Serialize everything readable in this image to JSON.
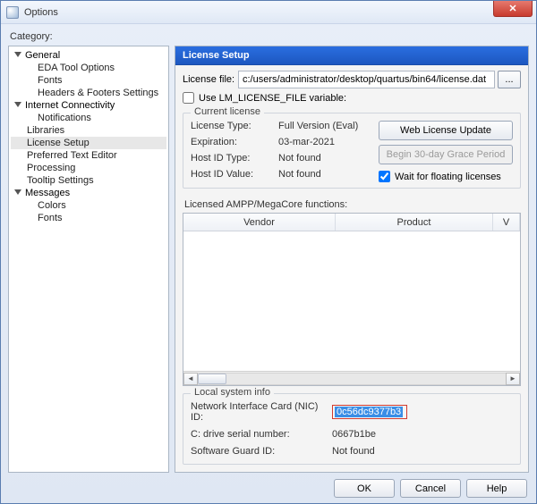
{
  "window": {
    "title": "Options"
  },
  "categoryLabel": "Category:",
  "tree": {
    "groups": [
      {
        "label": "General",
        "children": [
          {
            "label": "EDA Tool Options"
          },
          {
            "label": "Fonts"
          },
          {
            "label": "Headers & Footers Settings"
          }
        ]
      },
      {
        "label": "Internet Connectivity",
        "children": [
          {
            "label": "Notifications"
          }
        ]
      },
      {
        "label": "Libraries",
        "flat": true
      },
      {
        "label": "License Setup",
        "flat": true,
        "selected": true
      },
      {
        "label": "Preferred Text Editor",
        "flat": true
      },
      {
        "label": "Processing",
        "flat": true
      },
      {
        "label": "Tooltip Settings",
        "flat": true
      },
      {
        "label": "Messages",
        "children": [
          {
            "label": "Colors"
          },
          {
            "label": "Fonts"
          }
        ]
      }
    ]
  },
  "section": {
    "title": "License Setup"
  },
  "licenseFile": {
    "label": "License file:",
    "value": "c:/users/administrator/desktop/quartus/bin64/license.dat",
    "browse": "..."
  },
  "useEnvVar": {
    "label": "Use LM_LICENSE_FILE variable:",
    "checked": false
  },
  "currentLicense": {
    "legend": "Current license",
    "labels": {
      "licenseType": "License Type:",
      "expiration": "Expiration:",
      "hostIdType": "Host ID Type:",
      "hostIdValue": "Host ID Value:"
    },
    "values": {
      "licenseType": "Full Version (Eval)",
      "expiration": "03-mar-2021",
      "hostIdType": "Not found",
      "hostIdValue": "Not found"
    },
    "buttons": {
      "webUpdate": "Web License Update",
      "grace": "Begin 30-day Grace Period"
    },
    "waitFloating": {
      "label": "Wait for floating licenses",
      "checked": true
    }
  },
  "licensedTable": {
    "label": "Licensed AMPP/MegaCore functions:",
    "columns": {
      "vendor": "Vendor",
      "product": "Product",
      "v": "V"
    }
  },
  "sysinfo": {
    "legend": "Local system info",
    "nicLabel": "Network Interface Card (NIC) ID:",
    "nicValue": "0c56dc9377b3",
    "cdriveLabel": "C: drive serial number:",
    "cdriveValue": "0667b1be",
    "sgLabel": "Software Guard ID:",
    "sgValue": "Not found"
  },
  "footer": {
    "ok": "OK",
    "cancel": "Cancel",
    "help": "Help"
  }
}
